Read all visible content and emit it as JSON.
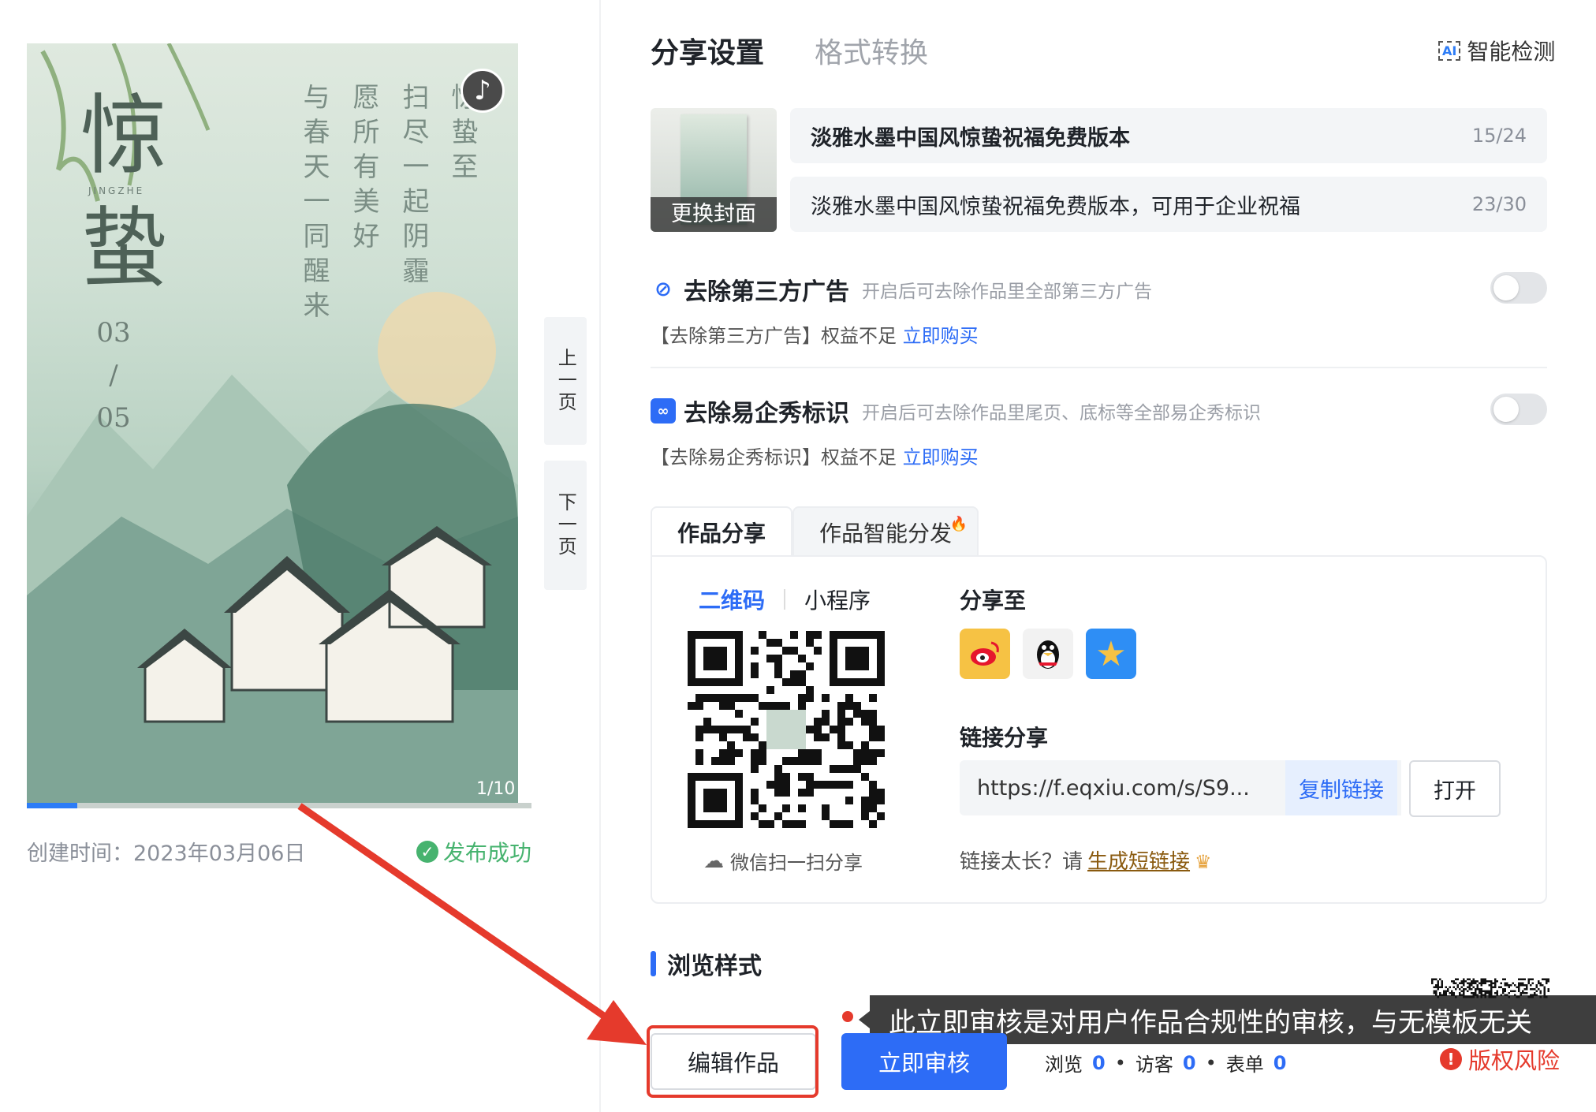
{
  "preview": {
    "title_chars": [
      "惊",
      "蛰"
    ],
    "pinyin": "JINGZHE",
    "date_top": "03",
    "date_sep": "/",
    "date_bottom": "05",
    "poem_lines": [
      "惊蛰至",
      "扫尽一起阴霾",
      "愿所有美好",
      "与春天一同醒来"
    ],
    "page_indicator": "1/10",
    "progress_fraction": 0.1,
    "prev_page": "上一页",
    "next_page": "下一页",
    "created_label": "创建时间：2023年03月06日",
    "publish_status": "发布成功"
  },
  "tabs": {
    "share_settings": "分享设置",
    "format_convert": "格式转换"
  },
  "smart_detect": "智能检测",
  "cover": {
    "change_label": "更换封面"
  },
  "title_field": {
    "value": "淡雅水墨中国风惊蛰祝福免费版本",
    "count": "15/24"
  },
  "desc_field": {
    "value": "淡雅水墨中国风惊蛰祝福免费版本，可用于企业祝福",
    "count": "23/30"
  },
  "features": [
    {
      "title": "去除第三方广告",
      "desc": "开启后可去除作品里全部第三方广告",
      "note_prefix": "【去除第三方广告】权益不足",
      "note_link": "立即购买",
      "enabled": false
    },
    {
      "title": "去除易企秀标识",
      "desc": "开启后可去除作品里尾页、底标等全部易企秀标识",
      "note_prefix": "【去除易企秀标识】权益不足",
      "note_link": "立即购买",
      "enabled": false
    }
  ],
  "share_tabs": [
    "作品分享",
    "作品智能分发"
  ],
  "qr_tabs": {
    "qrcode": "二维码",
    "miniprogram": "小程序"
  },
  "wechat_scan": "微信扫一扫分享",
  "share_to": "分享至",
  "socials": [
    "weibo-icon",
    "qq-icon",
    "qzone-icon"
  ],
  "link_share": {
    "heading": "链接分享",
    "url": "https://f.eqxiu.com/s/S9...",
    "copy": "复制链接",
    "open": "打开",
    "too_long_prefix": "链接太长？请",
    "gen_short": "生成短链接"
  },
  "browse_style": "浏览样式",
  "tooltip": "此立即审核是对用户作品合规性的审核，与无模板无关",
  "buttons": {
    "edit": "编辑作品",
    "audit": "立即审核"
  },
  "stats": {
    "views_label": "浏览",
    "views": "0",
    "visitors_label": "访客",
    "visitors": "0",
    "forms_label": "表单",
    "forms": "0"
  },
  "copyright_risk": "版权风险",
  "colors": {
    "accent": "#2d6cf6",
    "success": "#47b36f",
    "danger": "#e53a2c"
  }
}
